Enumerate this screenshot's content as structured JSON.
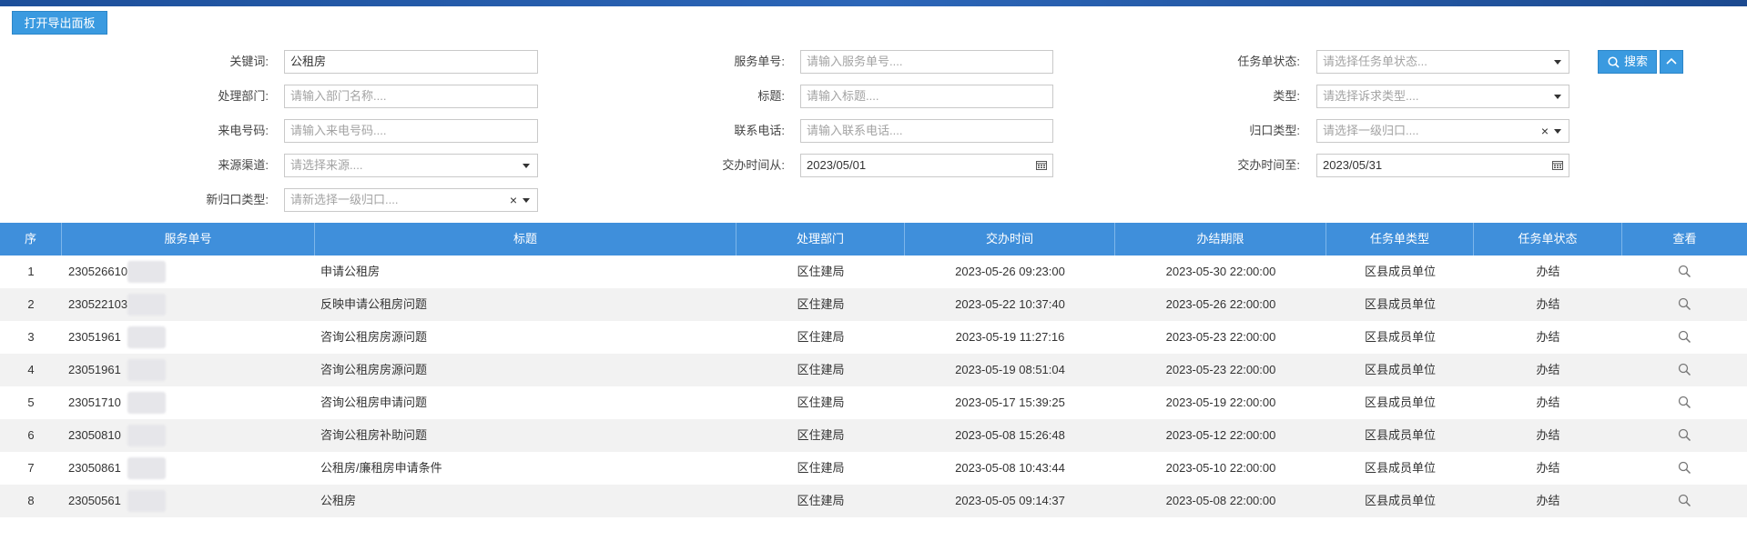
{
  "window": {
    "title_fragment": "— —"
  },
  "toolbar": {
    "export_label": "打开导出面板"
  },
  "filters": {
    "keyword": {
      "label": "关键词:",
      "value": "公租房"
    },
    "service_no": {
      "label": "服务单号:",
      "placeholder": "请输入服务单号...."
    },
    "task_status": {
      "label": "任务单状态:",
      "placeholder": "请选择任务单状态..."
    },
    "dept": {
      "label": "处理部门:",
      "placeholder": "请输入部门名称...."
    },
    "title": {
      "label": "标题:",
      "placeholder": "请输入标题...."
    },
    "type": {
      "label": "类型:",
      "placeholder": "请选择诉求类型...."
    },
    "caller": {
      "label": "来电号码:",
      "placeholder": "请输入来电号码...."
    },
    "phone": {
      "label": "联系电话:",
      "placeholder": "请输入联系电话...."
    },
    "category": {
      "label": "归口类型:",
      "placeholder": "请选择一级归口....",
      "clear": "×"
    },
    "channel": {
      "label": "来源渠道:",
      "placeholder": "请选择来源...."
    },
    "time_from": {
      "label": "交办时间从:",
      "value": "2023/05/01"
    },
    "time_to": {
      "label": "交办时间至:",
      "value": "2023/05/31"
    },
    "new_category": {
      "label": "新归口类型:",
      "placeholder": "请新选择一级归口....",
      "clear": "×"
    },
    "search_label": "搜索"
  },
  "table": {
    "headers": [
      "序",
      "服务单号",
      "标题",
      "处理部门",
      "交办时间",
      "办结期限",
      "任务单类型",
      "任务单状态",
      "查看"
    ],
    "rows": [
      {
        "seq": "1",
        "service_no": "230526610",
        "title": "申请公租房",
        "dept": "区住建局",
        "assigned": "2023-05-26 09:23:00",
        "deadline": "2023-05-30 22:00:00",
        "task_type": "区县成员单位",
        "status": "办结"
      },
      {
        "seq": "2",
        "service_no": "230522103",
        "title": "反映申请公租房问题",
        "dept": "区住建局",
        "assigned": "2023-05-22 10:37:40",
        "deadline": "2023-05-26 22:00:00",
        "task_type": "区县成员单位",
        "status": "办结"
      },
      {
        "seq": "3",
        "service_no": "23051961",
        "title": "咨询公租房房源问题",
        "dept": "区住建局",
        "assigned": "2023-05-19 11:27:16",
        "deadline": "2023-05-23 22:00:00",
        "task_type": "区县成员单位",
        "status": "办结"
      },
      {
        "seq": "4",
        "service_no": "23051961",
        "title": "咨询公租房房源问题",
        "dept": "区住建局",
        "assigned": "2023-05-19 08:51:04",
        "deadline": "2023-05-23 22:00:00",
        "task_type": "区县成员单位",
        "status": "办结"
      },
      {
        "seq": "5",
        "service_no": "23051710",
        "title": "咨询公租房申请问题",
        "dept": "区住建局",
        "assigned": "2023-05-17 15:39:25",
        "deadline": "2023-05-19 22:00:00",
        "task_type": "区县成员单位",
        "status": "办结"
      },
      {
        "seq": "6",
        "service_no": "23050810",
        "title": "咨询公租房补助问题",
        "dept": "区住建局",
        "assigned": "2023-05-08 15:26:48",
        "deadline": "2023-05-12 22:00:00",
        "task_type": "区县成员单位",
        "status": "办结"
      },
      {
        "seq": "7",
        "service_no": "23050861",
        "title": "公租房/廉租房申请条件",
        "dept": "区住建局",
        "assigned": "2023-05-08 10:43:44",
        "deadline": "2023-05-10 22:00:00",
        "task_type": "区县成员单位",
        "status": "办结"
      },
      {
        "seq": "8",
        "service_no": "23050561",
        "title": "公租房",
        "dept": "区住建局",
        "assigned": "2023-05-05 09:14:37",
        "deadline": "2023-05-08 22:00:00",
        "task_type": "区县成员单位",
        "status": "办结"
      }
    ]
  },
  "icons": {
    "view": "magnifier-icon",
    "search": "search-icon",
    "collapse": "chevron-up-icon",
    "calendar": "calendar-icon"
  },
  "colors": {
    "primary": "#3a9ae0",
    "header": "#3f8fdb",
    "topbar": "#2c66b8"
  }
}
